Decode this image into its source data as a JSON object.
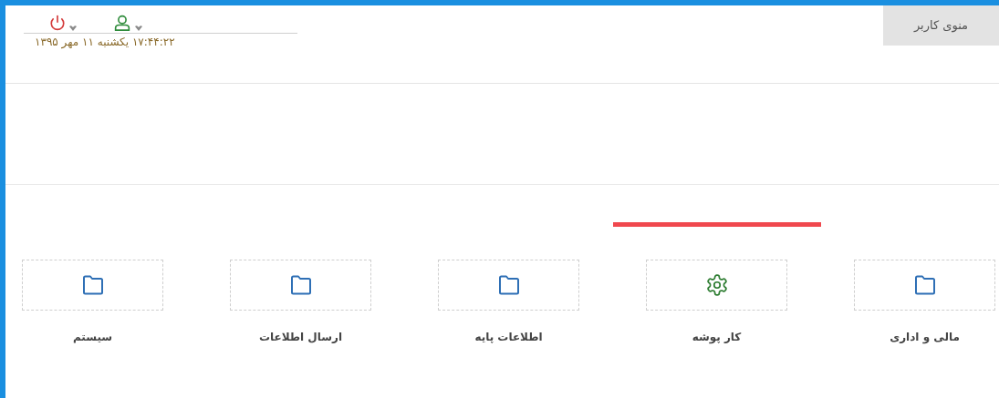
{
  "user_menu": {
    "label": "منوی کاربر"
  },
  "clock": {
    "text": "۱۷:۴۴:۲۲ یکشنبه ۱۱ مهر ۱۳۹۵"
  },
  "tiles": [
    {
      "label": "مالی و اداری",
      "kind": "folder",
      "selected": false
    },
    {
      "label": "کار پوشه",
      "kind": "gear",
      "selected": true
    },
    {
      "label": "اطلاعات پایه",
      "kind": "folder",
      "selected": false
    },
    {
      "label": "ارسال اطلاعات",
      "kind": "folder",
      "selected": false
    },
    {
      "label": "سیستم",
      "kind": "folder",
      "selected": false
    }
  ]
}
